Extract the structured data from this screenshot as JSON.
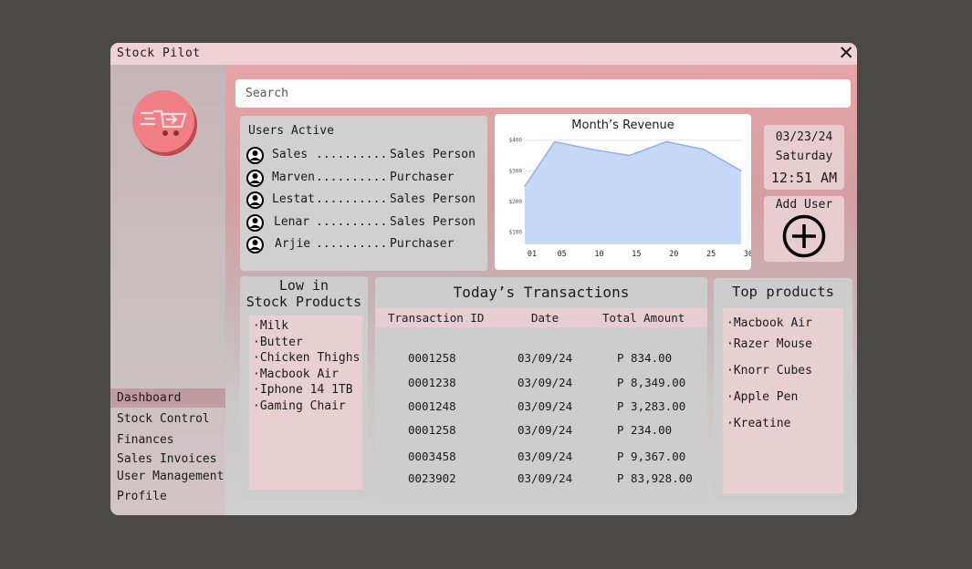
{
  "app": {
    "title": "Stock Pilot"
  },
  "search": {
    "placeholder": "Search"
  },
  "sidebar": {
    "items": [
      {
        "label": "Dashboard",
        "active": true
      },
      {
        "label": "Stock Control"
      },
      {
        "label": "Finances"
      },
      {
        "label": "Sales Invoices"
      },
      {
        "label": "User Management"
      },
      {
        "label": "Profile"
      }
    ]
  },
  "users_active": {
    "title": "Users Active",
    "users": [
      {
        "name": "Sales ",
        "dots": "..........",
        "role": "Sales Person"
      },
      {
        "name": "Marven",
        "dots": "..........",
        "role": "Purchaser"
      },
      {
        "name": "Lestat",
        "dots": "..........",
        "role": "Sales Person"
      },
      {
        "name": "Lenar ",
        "dots": "..........",
        "role": "Sales Person"
      },
      {
        "name": "Arjie ",
        "dots": "..........",
        "role": "Purchaser"
      }
    ]
  },
  "chart_data": {
    "type": "area",
    "title": "Month’s Revenue",
    "x": [
      1,
      5,
      10,
      15,
      20,
      25,
      30
    ],
    "x_ticks": [
      "01",
      "05",
      "10",
      "15",
      "20",
      "25",
      "30"
    ],
    "series": [
      {
        "values": [
          250,
          395,
          370,
          350,
          395,
          370,
          300
        ]
      }
    ],
    "y_ticks": [
      "$400",
      "$300",
      "$200",
      "$100"
    ],
    "ylim": [
      60,
      420
    ],
    "grid": true,
    "fill_color": "#c5d8f8",
    "line_color": "#8fb0e6"
  },
  "datetime": {
    "date": "03/23/24",
    "day": "Saturday",
    "time": "12:51 AM"
  },
  "add_user": {
    "label": "Add User"
  },
  "low_stock": {
    "title_line1": "Low in",
    "title_line2": "Stock Products",
    "items": [
      "Milk",
      "Butter",
      "Chicken Thighs",
      "Macbook Air",
      "Iphone 14 1TB",
      "Gaming Chair"
    ]
  },
  "transactions": {
    "title": "Today’s Transactions",
    "headers": [
      "Transaction ID",
      "Date",
      "Total Amount"
    ],
    "rows": [
      {
        "id": "0001258",
        "date": "03/09/24",
        "amount": "P 834.00"
      },
      {
        "id": "0001238",
        "date": "03/09/24",
        "amount": "P 8,349.00"
      },
      {
        "id": "0001248",
        "date": "03/09/24",
        "amount": "P 3,283.00"
      },
      {
        "id": "0001258",
        "date": "03/09/24",
        "amount": "P 234.00"
      },
      {
        "id": "0003458",
        "date": "03/09/24",
        "amount": "P 9,367.00"
      },
      {
        "id": "0023902",
        "date": "03/09/24",
        "amount": "P 83,928.00"
      }
    ]
  },
  "top_products": {
    "title": "Top products",
    "items": [
      "Macbook Air",
      "Razer Mouse",
      "Knorr Cubes",
      "Apple Pen",
      "Kreatine"
    ]
  },
  "colors": {
    "accent": "#f07f86",
    "panel_pink": "#e8cdd0",
    "header_pink": "#f0d2d6"
  }
}
